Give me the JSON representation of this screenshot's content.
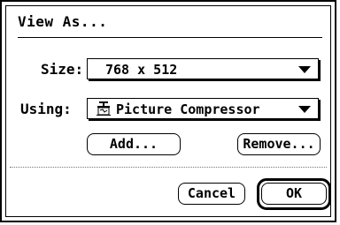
{
  "dialog": {
    "title": "View As..."
  },
  "size_field": {
    "label": "Size:",
    "value": "768 x 512"
  },
  "using_field": {
    "label": "Using:",
    "value": "Picture Compressor",
    "icon": "compressor-icon"
  },
  "buttons": {
    "add": "Add...",
    "remove": "Remove...",
    "cancel": "Cancel",
    "ok": "OK"
  }
}
